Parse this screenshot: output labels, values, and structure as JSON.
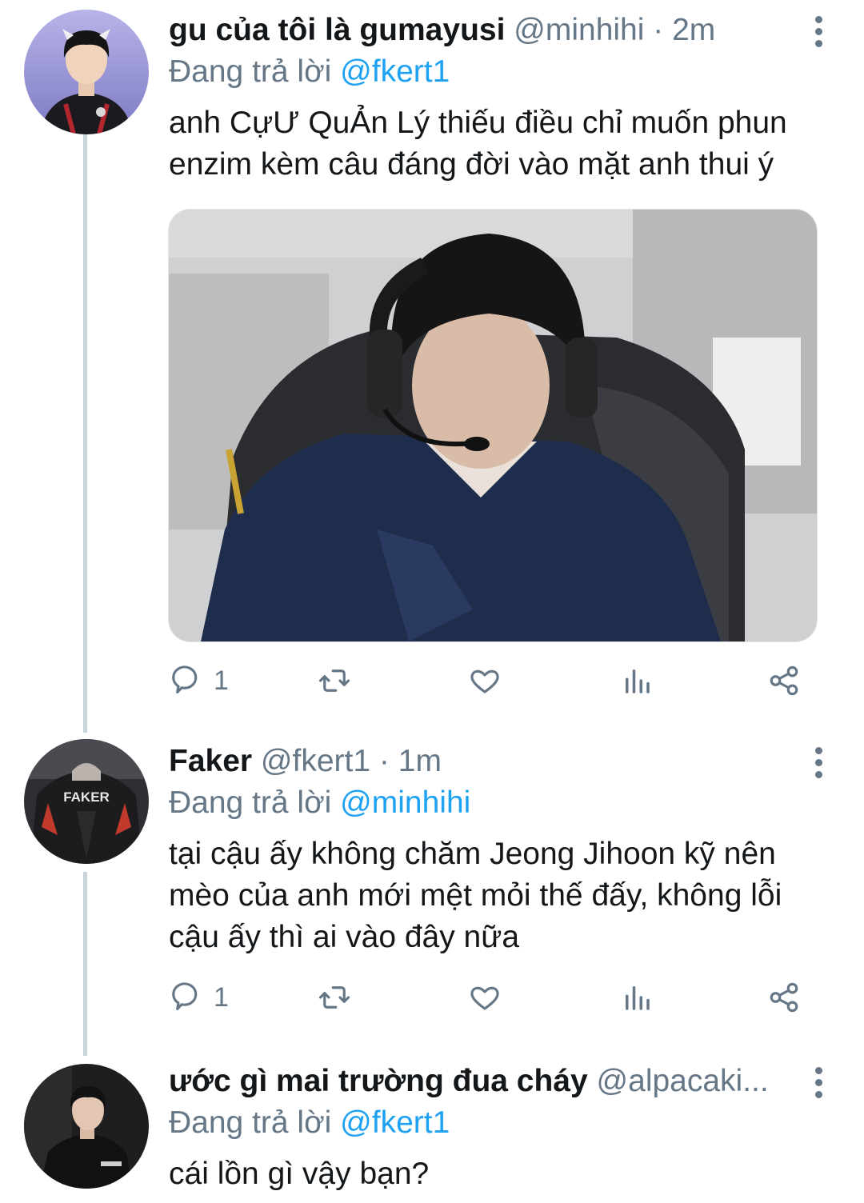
{
  "tweets": [
    {
      "name": "gu của tôi là gumayusi",
      "handle": "@minhihi",
      "separator": "·",
      "time": "2m",
      "reply_prefix": "Đang trả lời",
      "reply_to": "@fkert1",
      "text": "anh CựƯ QuẢn Lý thiếu điều chỉ muốn phun enzim kèm câu đáng đời vào mặt anh thui ý",
      "has_media": true,
      "reply_count": "1"
    },
    {
      "name": "Faker",
      "handle": "@fkert1",
      "separator": "·",
      "time": "1m",
      "reply_prefix": "Đang trả lời",
      "reply_to": "@minhihi",
      "text": "tại cậu ấy không chăm Jeong Jihoon kỹ nên mèo của anh mới mệt mỏi thế đấy, không lỗi cậu ấy thì ai vào đây nữa",
      "avatar_jacket_text": "FAKER",
      "reply_count": "1"
    },
    {
      "name": "ước gì mai trường đua cháy",
      "handle": "@alpacaki...",
      "reply_prefix": "Đang trả lời",
      "reply_to": "@fkert1",
      "text": "cái lồn gì vậy bạn?"
    }
  ],
  "icons": {
    "reply": "reply-icon",
    "retweet": "retweet-icon",
    "like": "heart-icon",
    "analytics": "analytics-icon",
    "share": "share-icon",
    "more": "more-vertical-icon"
  },
  "colors": {
    "text": "#14171a",
    "secondary": "#657786",
    "link": "#1da1f2",
    "thread_line": "#c9d3da"
  }
}
